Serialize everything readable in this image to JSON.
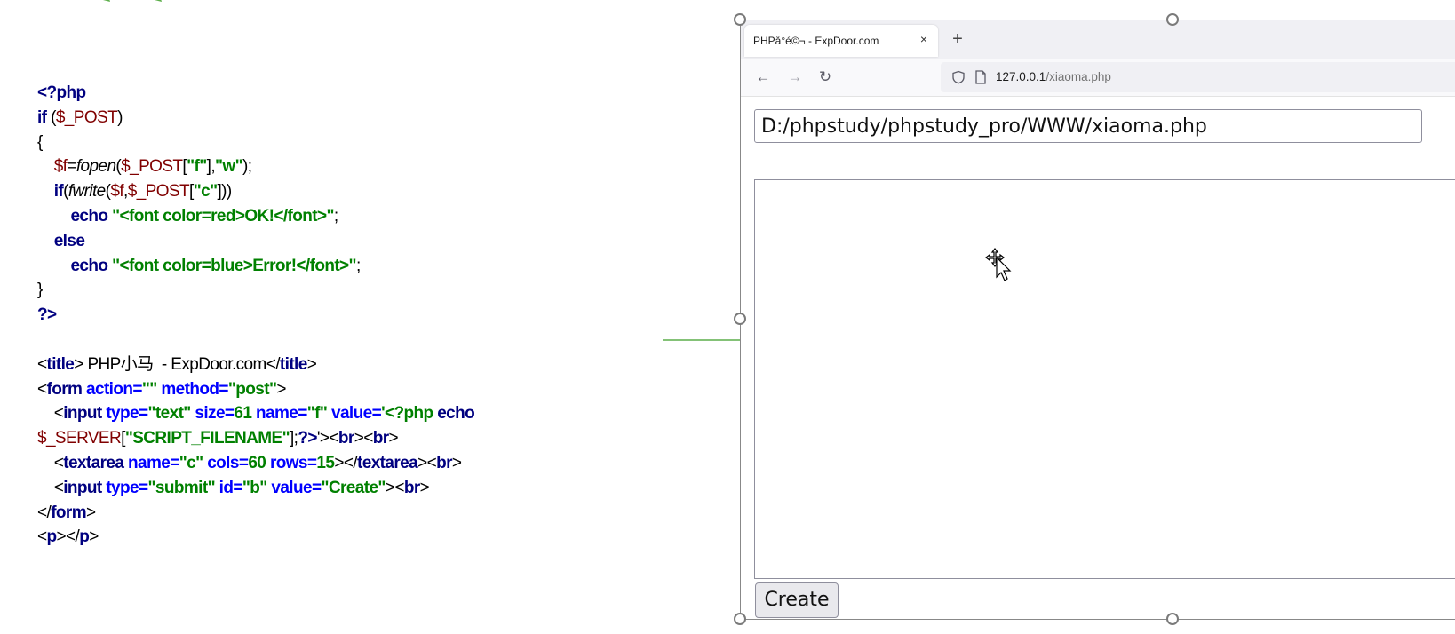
{
  "code_listing": {
    "lines": [
      [
        {
          "t": "<?php",
          "c": "kw"
        }
      ],
      [
        {
          "t": "if",
          "c": "kw"
        },
        {
          "t": " (",
          "c": "plain"
        },
        {
          "t": "$_POST",
          "c": "var"
        },
        {
          "t": ")",
          "c": "plain"
        }
      ],
      [
        {
          "t": "{",
          "c": "plain"
        }
      ],
      [
        {
          "t": "    ",
          "c": "plain"
        },
        {
          "t": "$f",
          "c": "var"
        },
        {
          "t": "=",
          "c": "plain"
        },
        {
          "t": "fopen",
          "c": "fn"
        },
        {
          "t": "(",
          "c": "plain"
        },
        {
          "t": "$_POST",
          "c": "var"
        },
        {
          "t": "[",
          "c": "plain"
        },
        {
          "t": "\"f\"",
          "c": "str"
        },
        {
          "t": "],",
          "c": "plain"
        },
        {
          "t": "\"w\"",
          "c": "str"
        },
        {
          "t": ");",
          "c": "plain"
        }
      ],
      [
        {
          "t": "    ",
          "c": "plain"
        },
        {
          "t": "if",
          "c": "kw"
        },
        {
          "t": "(",
          "c": "plain"
        },
        {
          "t": "fwrite",
          "c": "fn"
        },
        {
          "t": "(",
          "c": "plain"
        },
        {
          "t": "$f",
          "c": "var"
        },
        {
          "t": ",",
          "c": "plain"
        },
        {
          "t": "$_POST",
          "c": "var"
        },
        {
          "t": "[",
          "c": "plain"
        },
        {
          "t": "\"c\"",
          "c": "str"
        },
        {
          "t": "]))",
          "c": "plain"
        }
      ],
      [
        {
          "t": "        ",
          "c": "plain"
        },
        {
          "t": "echo",
          "c": "kw"
        },
        {
          "t": " ",
          "c": "plain"
        },
        {
          "t": "\"<font color=red>OK!</font>\"",
          "c": "str"
        },
        {
          "t": ";",
          "c": "plain"
        }
      ],
      [
        {
          "t": "    ",
          "c": "plain"
        },
        {
          "t": "else",
          "c": "kw"
        }
      ],
      [
        {
          "t": "        ",
          "c": "plain"
        },
        {
          "t": "echo",
          "c": "kw"
        },
        {
          "t": " ",
          "c": "plain"
        },
        {
          "t": "\"<font color=blue>Error!</font>\"",
          "c": "str"
        },
        {
          "t": ";",
          "c": "plain"
        }
      ],
      [
        {
          "t": "}",
          "c": "plain"
        }
      ],
      [
        {
          "t": "?>",
          "c": "kw"
        }
      ],
      [
        {
          "t": "",
          "c": "plain"
        }
      ],
      [
        {
          "t": "<",
          "c": "plain"
        },
        {
          "t": "title",
          "c": "tag"
        },
        {
          "t": "> PHP小马  - ExpDoor.com</",
          "c": "plain"
        },
        {
          "t": "title",
          "c": "tag"
        },
        {
          "t": ">",
          "c": "plain"
        }
      ],
      [
        {
          "t": "<",
          "c": "plain"
        },
        {
          "t": "form",
          "c": "tag"
        },
        {
          "t": " action=",
          "c": "attr"
        },
        {
          "t": "\"\"",
          "c": "str"
        },
        {
          "t": " method=",
          "c": "attr"
        },
        {
          "t": "\"post\"",
          "c": "str"
        },
        {
          "t": ">",
          "c": "plain"
        }
      ],
      [
        {
          "t": "    <",
          "c": "plain"
        },
        {
          "t": "input",
          "c": "tag"
        },
        {
          "t": " type=",
          "c": "attr"
        },
        {
          "t": "\"text\"",
          "c": "str"
        },
        {
          "t": " size=",
          "c": "attr"
        },
        {
          "t": "61",
          "c": "str"
        },
        {
          "t": " name=",
          "c": "attr"
        },
        {
          "t": "\"f\"",
          "c": "str"
        },
        {
          "t": " value=",
          "c": "attr"
        },
        {
          "t": "'<?php",
          "c": "str"
        },
        {
          "t": " echo",
          "c": "kw"
        }
      ],
      [
        {
          "t": "$_SERVER",
          "c": "var"
        },
        {
          "t": "[",
          "c": "plain"
        },
        {
          "t": "\"SCRIPT_FILENAME\"",
          "c": "str"
        },
        {
          "t": "];",
          "c": "plain"
        },
        {
          "t": "?>",
          "c": "kw"
        },
        {
          "t": "'><",
          "c": "plain"
        },
        {
          "t": "br",
          "c": "tag"
        },
        {
          "t": "><",
          "c": "plain"
        },
        {
          "t": "br",
          "c": "tag"
        },
        {
          "t": ">",
          "c": "plain"
        }
      ],
      [
        {
          "t": "    <",
          "c": "plain"
        },
        {
          "t": "textarea",
          "c": "tag"
        },
        {
          "t": " name=",
          "c": "attr"
        },
        {
          "t": "\"c\"",
          "c": "str"
        },
        {
          "t": " cols=",
          "c": "attr"
        },
        {
          "t": "60",
          "c": "str"
        },
        {
          "t": " rows=",
          "c": "attr"
        },
        {
          "t": "15",
          "c": "str"
        },
        {
          "t": "></",
          "c": "plain"
        },
        {
          "t": "textarea",
          "c": "tag"
        },
        {
          "t": "><",
          "c": "plain"
        },
        {
          "t": "br",
          "c": "tag"
        },
        {
          "t": ">",
          "c": "plain"
        }
      ],
      [
        {
          "t": "    <",
          "c": "plain"
        },
        {
          "t": "input",
          "c": "tag"
        },
        {
          "t": " type=",
          "c": "attr"
        },
        {
          "t": "\"submit\"",
          "c": "str"
        },
        {
          "t": " id=",
          "c": "attr"
        },
        {
          "t": "\"b\"",
          "c": "str"
        },
        {
          "t": " value=",
          "c": "attr"
        },
        {
          "t": "\"Create\"",
          "c": "str"
        },
        {
          "t": "><",
          "c": "plain"
        },
        {
          "t": "br",
          "c": "tag"
        },
        {
          "t": ">",
          "c": "plain"
        }
      ],
      [
        {
          "t": "</",
          "c": "plain"
        },
        {
          "t": "form",
          "c": "tag"
        },
        {
          "t": ">",
          "c": "plain"
        }
      ],
      [
        {
          "t": "<",
          "c": "plain"
        },
        {
          "t": "p",
          "c": "tag"
        },
        {
          "t": "></",
          "c": "plain"
        },
        {
          "t": "p",
          "c": "tag"
        },
        {
          "t": ">",
          "c": "plain"
        }
      ]
    ]
  },
  "browser": {
    "tab": {
      "title": "PHPå°é©¬ - ExpDoor.com",
      "close_icon": "×"
    },
    "new_tab_icon": "+",
    "nav": {
      "back_icon": "←",
      "forward_icon": "→",
      "reload_icon": "↻"
    },
    "url": {
      "host": "127.0.0.1",
      "path": "/xiaoma.php"
    },
    "form": {
      "path_value": "D:/phpstudy/phpstudy_pro/WWW/xiaoma.php",
      "textarea_value": "",
      "submit_label": "Create"
    }
  },
  "colors": {
    "keyword": "#000080",
    "variable": "#800000",
    "string": "#008000",
    "attribute": "#0000ff",
    "arrow": "#5cae4a"
  }
}
